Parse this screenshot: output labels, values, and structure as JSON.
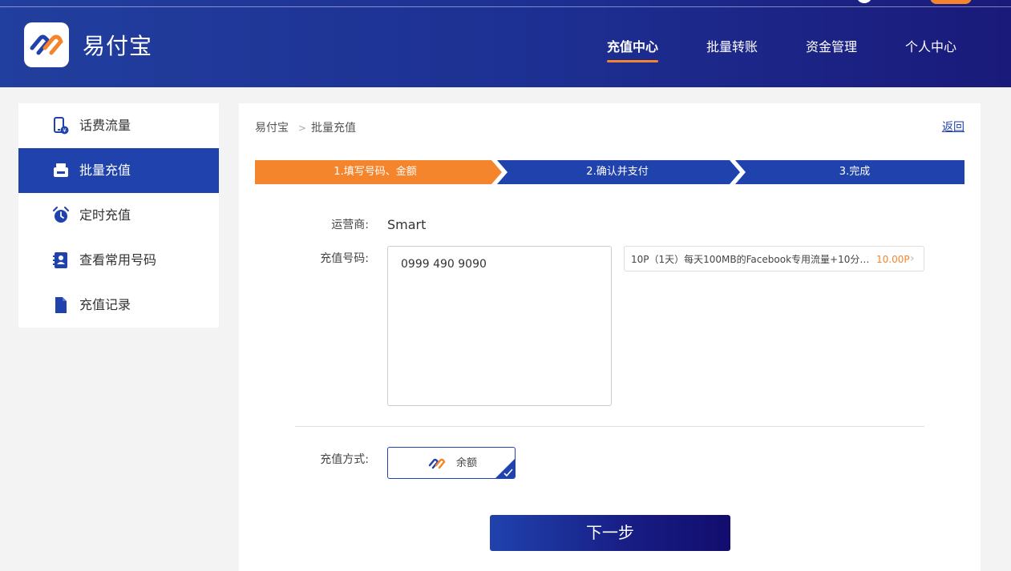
{
  "header": {
    "brand": "易付宝",
    "nav": [
      {
        "label": "充值中心",
        "active": true
      },
      {
        "label": "批量转账",
        "active": false
      },
      {
        "label": "资金管理",
        "active": false
      },
      {
        "label": "个人中心",
        "active": false
      }
    ]
  },
  "sidebar": {
    "items": [
      {
        "label": "话费流量",
        "icon": "phone-yen-icon",
        "active": false
      },
      {
        "label": "批量充值",
        "icon": "printer-icon",
        "active": true
      },
      {
        "label": "定时充值",
        "icon": "alarm-clock-icon",
        "active": false
      },
      {
        "label": "查看常用号码",
        "icon": "contact-book-icon",
        "active": false
      },
      {
        "label": "充值记录",
        "icon": "document-icon",
        "active": false
      }
    ]
  },
  "breadcrumb": {
    "home": "易付宝",
    "separator": ">",
    "current": "批量充值"
  },
  "back_label": "返回",
  "steps": [
    {
      "label": "1.填写号码、金额",
      "active": true
    },
    {
      "label": "2.确认并支付",
      "active": false
    },
    {
      "label": "3.完成",
      "active": false
    }
  ],
  "form": {
    "carrier_label": "运营商:",
    "carrier_value": "Smart",
    "phone_label": "充值号码:",
    "phone_value": "0999 490 9090",
    "package": {
      "text": "10P（1天）每天100MB的Facebook专用流量+10分钟…",
      "price": "10.00P"
    },
    "pay_label": "充值方式:",
    "pay_option": "余额"
  },
  "next_button": "下一步",
  "colors": {
    "primary": "#2042ad",
    "accent": "#f5852c",
    "header_dark": "#1a1a7a"
  }
}
